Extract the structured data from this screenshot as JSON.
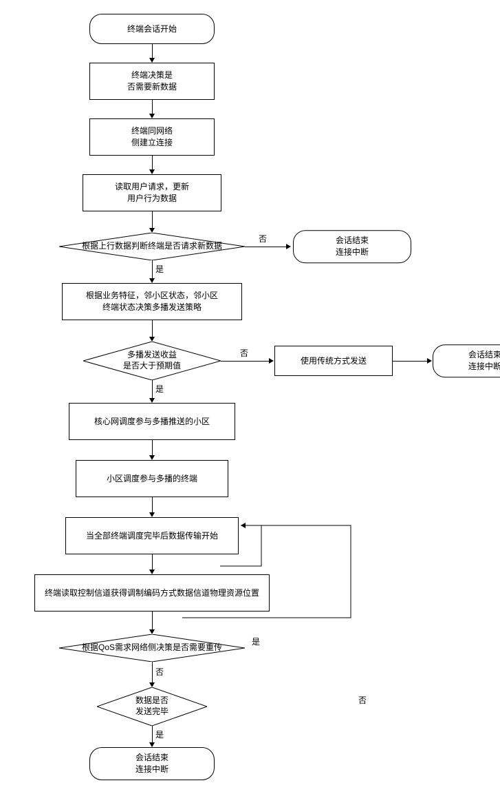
{
  "nodes": {
    "start": "终端会话开始",
    "n1": "终端决策是\n否需要新数据",
    "n2": "终端同网络\n侧建立连接",
    "n3": "读取用户请求，更新\n用户行为数据",
    "d1": "根据上行数据判断终端是否请求新数据",
    "end1": "会话结束\n连接中断",
    "n4": "根据业务特征，邻小区状态，邻小区\n终端状态决策多播发送策略",
    "d2": "多播发送收益\n是否大于预期值",
    "alt": "使用传统方式发送",
    "end2": "会话结束\n连接中断",
    "n5": "核心网调度参与多播推送的小区",
    "n6": "小区调度参与多播的终端",
    "n7": "当全部终端调度完毕后数据传输开始",
    "n8": "终端读取控制信道获得调制编码方式数据信道物理资源位置",
    "d3": "根据QoS需求网络侧决策是否需要重传",
    "d4": "数据是否\n发送完毕",
    "end3": "会话结束\n连接中断"
  },
  "labels": {
    "yes": "是",
    "no": "否"
  }
}
